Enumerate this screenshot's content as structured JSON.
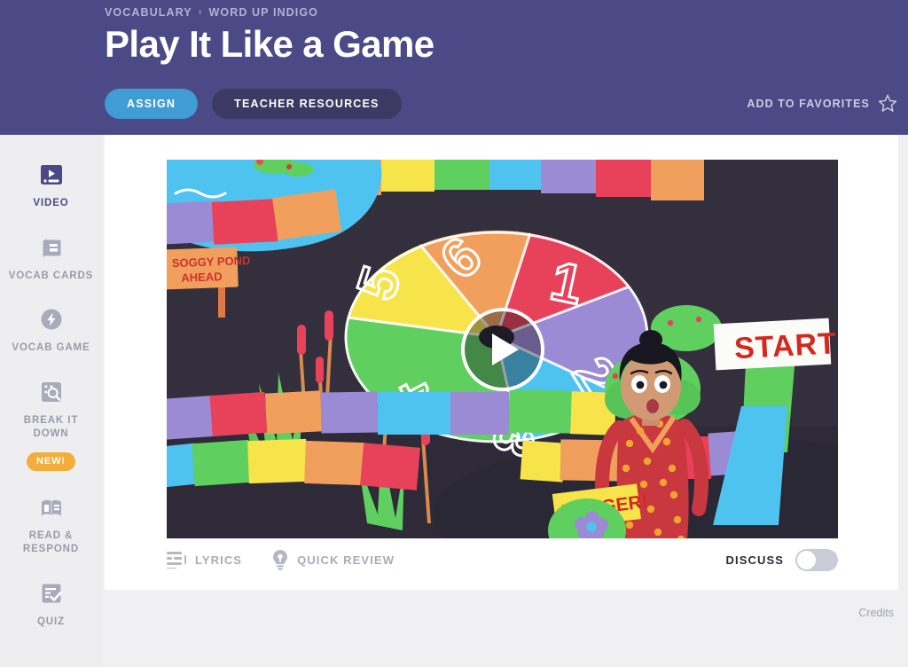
{
  "header": {
    "breadcrumb": {
      "root": "VOCABULARY",
      "separator": "›",
      "current": "WORD UP INDIGO"
    },
    "title": "Play It Like a Game",
    "assign_label": "ASSIGN",
    "teacher_resources_label": "TEACHER RESOURCES",
    "favorites_label": "ADD TO FAVORITES",
    "favorites_icon": "star-outline-icon",
    "bg_color": "#4b4a87",
    "assign_color": "#3f9dd4",
    "teacher_color": "#3c3a63"
  },
  "sidebar": {
    "bg_color": "#eeeef1",
    "active_color": "#4b4a87",
    "inactive_color": "#9a9aab",
    "items": [
      {
        "label": "VIDEO",
        "icon": "video-player-icon",
        "active": true
      },
      {
        "label": "VOCAB CARDS",
        "icon": "cards-icon",
        "active": false
      },
      {
        "label": "VOCAB GAME",
        "icon": "lightning-bolt-icon",
        "active": false
      },
      {
        "label": "BREAK IT DOWN",
        "icon": "magnifier-grid-icon",
        "active": false,
        "badge": "NEW!"
      },
      {
        "label": "READ & RESPOND",
        "icon": "open-book-icon",
        "active": false
      },
      {
        "label": "QUIZ",
        "icon": "checklist-icon",
        "active": false
      }
    ],
    "badge_color": "#f2ad3a"
  },
  "main": {
    "video": {
      "play_icon": "play-triangle-icon",
      "alt_description": "Illustrated board game path with a colorful spinner, a character, and signs",
      "scene": {
        "start_sign": "START",
        "danger_sign": "DANGER!",
        "pond_sign_line1": "SOGGY POND",
        "pond_sign_line2": "AHEAD",
        "spinner_numbers": [
          "1",
          "2",
          "3",
          "4",
          "5",
          "6"
        ]
      }
    },
    "controls": {
      "lyrics_label": "LYRICS",
      "lyrics_icon": "lyrics-lines-icon",
      "quick_review_label": "QUICK REVIEW",
      "quick_review_icon": "lightbulb-icon",
      "discuss_label": "DISCUSS",
      "discuss_toggle": "off"
    }
  },
  "footer": {
    "credits_label": "Credits"
  }
}
